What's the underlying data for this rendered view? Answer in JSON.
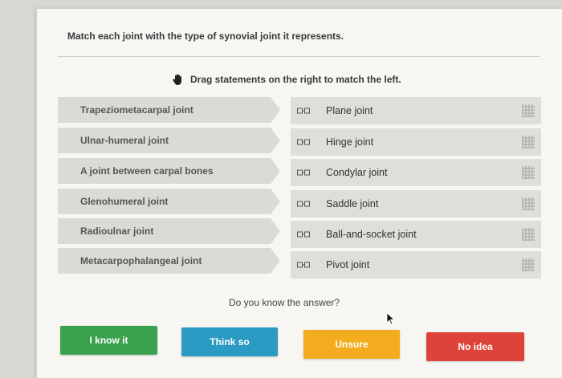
{
  "question": "Match each joint with the type of synovial joint it represents.",
  "instruction": "Drag statements on the right to match the left.",
  "left_items": [
    "Trapeziometacarpal joint",
    "Ulnar-humeral joint",
    "A joint between carpal bones",
    "Glenohumeral joint",
    "Radioulnar joint",
    "Metacarpophalangeal joint"
  ],
  "right_items": [
    "Plane joint",
    "Hinge joint",
    "Condylar joint",
    "Saddle joint",
    "Ball-and-socket joint",
    "Pivot joint"
  ],
  "prompt": "Do you know the answer?",
  "buttons": {
    "know": "I know it",
    "think": "Think so",
    "unsure": "Unsure",
    "no_idea": "No idea"
  },
  "colors": {
    "know": "#3aa14f",
    "think": "#2c9bc4",
    "unsure": "#f2ac1e",
    "no_idea": "#dd4338"
  },
  "icons": {
    "instruction": "hand-icon",
    "pair": "link-icon",
    "drag": "grip-icon"
  }
}
